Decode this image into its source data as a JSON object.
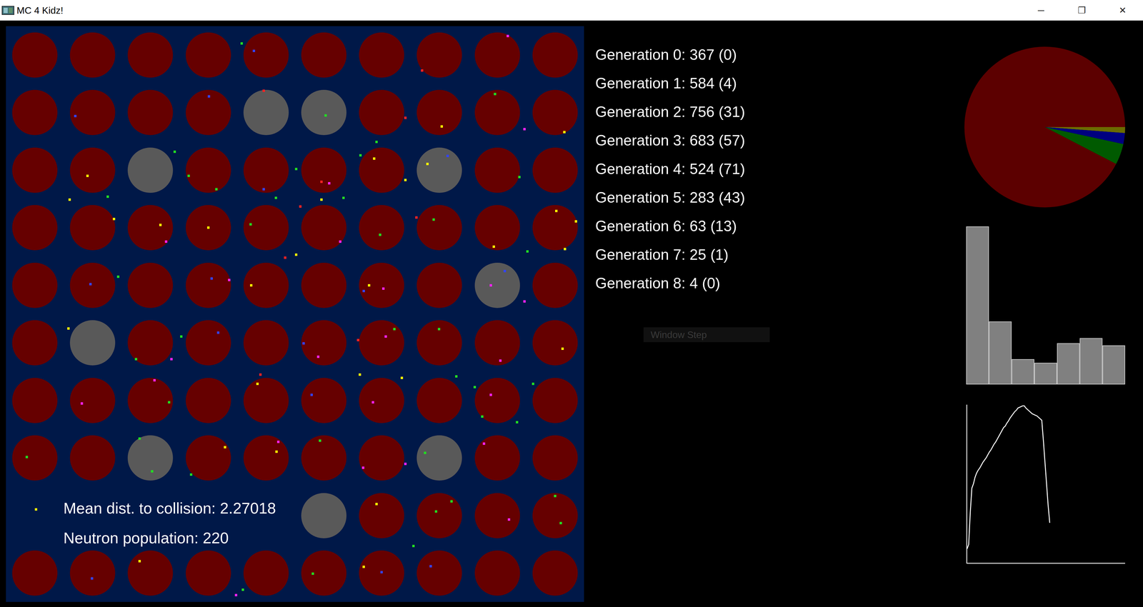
{
  "window": {
    "title": "MC 4 Kidz!",
    "controls": [
      "─",
      "❐",
      "✕"
    ]
  },
  "reactor": {
    "rows": [
      [
        "fuel",
        "fuel",
        "fuel",
        "fuel",
        "fuel",
        "fuel",
        "fuel",
        "fuel",
        "fuel",
        "fuel"
      ],
      [
        "fuel",
        "fuel",
        "fuel",
        "fuel",
        "spent",
        "spent",
        "fuel",
        "fuel",
        "fuel",
        "fuel"
      ],
      [
        "fuel",
        "fuel",
        "spent",
        "fuel",
        "fuel",
        "fuel",
        "fuel",
        "spent",
        "fuel",
        "fuel"
      ],
      [
        "fuel",
        "fuel",
        "fuel",
        "fuel",
        "fuel",
        "fuel",
        "fuel",
        "fuel",
        "fuel",
        "fuel"
      ],
      [
        "fuel",
        "fuel",
        "fuel",
        "fuel",
        "fuel",
        "fuel",
        "fuel",
        "fuel",
        "spent",
        "fuel"
      ],
      [
        "fuel",
        "spent",
        "fuel",
        "fuel",
        "fuel",
        "fuel",
        "fuel",
        "fuel",
        "fuel",
        "fuel"
      ],
      [
        "fuel",
        "fuel",
        "fuel",
        "fuel",
        "fuel",
        "fuel",
        "fuel",
        "fuel",
        "fuel",
        "fuel"
      ],
      [
        "fuel",
        "fuel",
        "spent",
        "fuel",
        "fuel",
        "fuel",
        "fuel",
        "spent",
        "fuel",
        "fuel"
      ],
      [
        "empty",
        "empty",
        "empty",
        "empty",
        "empty",
        "spent",
        "fuel",
        "fuel",
        "fuel",
        "fuel"
      ],
      [
        "fuel",
        "fuel",
        "fuel",
        "fuel",
        "fuel",
        "fuel",
        "fuel",
        "fuel",
        "fuel",
        "fuel"
      ]
    ],
    "neutrons": [
      {
        "x": 40.6,
        "y": 2.8,
        "color": "#22dd22"
      },
      {
        "x": 42.7,
        "y": 4.1,
        "color": "#3344ff"
      },
      {
        "x": 86.6,
        "y": 1.5,
        "color": "#ff22ff"
      },
      {
        "x": 71.8,
        "y": 7.5,
        "color": "#ff2222"
      },
      {
        "x": 34.9,
        "y": 12.0,
        "color": "#3344ff"
      },
      {
        "x": 11.8,
        "y": 15.4,
        "color": "#3344ff"
      },
      {
        "x": 44.4,
        "y": 11.0,
        "color": "#ff2222"
      },
      {
        "x": 55.1,
        "y": 15.3,
        "color": "#22dd22"
      },
      {
        "x": 84.4,
        "y": 11.6,
        "color": "#22dd22"
      },
      {
        "x": 75.2,
        "y": 17.2,
        "color": "#ffff00"
      },
      {
        "x": 68.9,
        "y": 15.7,
        "color": "#ff2222"
      },
      {
        "x": 89.5,
        "y": 17.7,
        "color": "#ff22ff"
      },
      {
        "x": 96.4,
        "y": 18.2,
        "color": "#ffff00"
      },
      {
        "x": 63.9,
        "y": 19.9,
        "color": "#22dd22"
      },
      {
        "x": 29.0,
        "y": 21.6,
        "color": "#22dd22"
      },
      {
        "x": 13.9,
        "y": 25.8,
        "color": "#ffff00"
      },
      {
        "x": 31.4,
        "y": 25.8,
        "color": "#22dd22"
      },
      {
        "x": 36.2,
        "y": 28.1,
        "color": "#22dd22"
      },
      {
        "x": 44.4,
        "y": 28.1,
        "color": "#3344ff"
      },
      {
        "x": 50.0,
        "y": 24.6,
        "color": "#22dd22"
      },
      {
        "x": 54.4,
        "y": 26.8,
        "color": "#ff2222"
      },
      {
        "x": 55.7,
        "y": 27.1,
        "color": "#ff22ff"
      },
      {
        "x": 61.1,
        "y": 22.2,
        "color": "#22dd22"
      },
      {
        "x": 63.5,
        "y": 22.8,
        "color": "#ffff00"
      },
      {
        "x": 72.7,
        "y": 23.7,
        "color": "#ffff00"
      },
      {
        "x": 76.2,
        "y": 22.3,
        "color": "#3344ff"
      },
      {
        "x": 68.9,
        "y": 26.5,
        "color": "#ffff00"
      },
      {
        "x": 88.6,
        "y": 26.0,
        "color": "#22dd22"
      },
      {
        "x": 17.4,
        "y": 29.4,
        "color": "#22dd22"
      },
      {
        "x": 10.8,
        "y": 29.9,
        "color": "#ffff00"
      },
      {
        "x": 46.5,
        "y": 29.6,
        "color": "#22dd22"
      },
      {
        "x": 50.7,
        "y": 31.1,
        "color": "#ff2222"
      },
      {
        "x": 54.4,
        "y": 29.9,
        "color": "#ffff00"
      },
      {
        "x": 58.2,
        "y": 29.6,
        "color": "#22dd22"
      },
      {
        "x": 18.5,
        "y": 33.3,
        "color": "#ffff00"
      },
      {
        "x": 26.5,
        "y": 34.3,
        "color": "#ffff00"
      },
      {
        "x": 27.5,
        "y": 37.2,
        "color": "#ff22ff"
      },
      {
        "x": 34.8,
        "y": 34.8,
        "color": "#ffff00"
      },
      {
        "x": 42.1,
        "y": 34.2,
        "color": "#22dd22"
      },
      {
        "x": 57.6,
        "y": 37.2,
        "color": "#ff22ff"
      },
      {
        "x": 64.5,
        "y": 36.0,
        "color": "#22dd22"
      },
      {
        "x": 70.8,
        "y": 33.0,
        "color": "#ff2222"
      },
      {
        "x": 73.8,
        "y": 33.4,
        "color": "#22dd22"
      },
      {
        "x": 84.2,
        "y": 38.1,
        "color": "#ffff00"
      },
      {
        "x": 95.0,
        "y": 31.9,
        "color": "#ffff00"
      },
      {
        "x": 98.4,
        "y": 33.7,
        "color": "#ffff00"
      },
      {
        "x": 90.0,
        "y": 38.9,
        "color": "#22dd22"
      },
      {
        "x": 96.5,
        "y": 38.5,
        "color": "#ffff00"
      },
      {
        "x": 14.4,
        "y": 44.6,
        "color": "#3344ff"
      },
      {
        "x": 19.2,
        "y": 43.3,
        "color": "#22dd22"
      },
      {
        "x": 35.4,
        "y": 43.6,
        "color": "#3344ff"
      },
      {
        "x": 38.4,
        "y": 43.9,
        "color": "#ff22ff"
      },
      {
        "x": 42.2,
        "y": 44.8,
        "color": "#ffff00"
      },
      {
        "x": 48.1,
        "y": 40.0,
        "color": "#ff2222"
      },
      {
        "x": 50.0,
        "y": 39.5,
        "color": "#ffff00"
      },
      {
        "x": 62.6,
        "y": 44.8,
        "color": "#ffff00"
      },
      {
        "x": 61.7,
        "y": 45.8,
        "color": "#3344ff"
      },
      {
        "x": 65.1,
        "y": 45.4,
        "color": "#ff22ff"
      },
      {
        "x": 83.7,
        "y": 44.8,
        "color": "#ff22ff"
      },
      {
        "x": 86.1,
        "y": 42.3,
        "color": "#3344ff"
      },
      {
        "x": 89.5,
        "y": 47.6,
        "color": "#ff22ff"
      },
      {
        "x": 10.6,
        "y": 52.3,
        "color": "#ffff00"
      },
      {
        "x": 30.1,
        "y": 53.7,
        "color": "#22dd22"
      },
      {
        "x": 36.5,
        "y": 53.0,
        "color": "#3344ff"
      },
      {
        "x": 51.3,
        "y": 54.9,
        "color": "#3344ff"
      },
      {
        "x": 53.8,
        "y": 57.2,
        "color": "#ff22ff"
      },
      {
        "x": 60.7,
        "y": 54.3,
        "color": "#ff2222"
      },
      {
        "x": 65.5,
        "y": 53.7,
        "color": "#ff22ff"
      },
      {
        "x": 67.0,
        "y": 52.4,
        "color": "#22dd22"
      },
      {
        "x": 74.7,
        "y": 52.4,
        "color": "#22dd22"
      },
      {
        "x": 85.3,
        "y": 57.9,
        "color": "#ff22ff"
      },
      {
        "x": 96.1,
        "y": 55.8,
        "color": "#ffff00"
      },
      {
        "x": 22.3,
        "y": 57.6,
        "color": "#22dd22"
      },
      {
        "x": 28.4,
        "y": 57.6,
        "color": "#ff22ff"
      },
      {
        "x": 12.9,
        "y": 65.3,
        "color": "#ff22ff"
      },
      {
        "x": 25.5,
        "y": 61.3,
        "color": "#ff22ff"
      },
      {
        "x": 28.0,
        "y": 65.1,
        "color": "#22dd22"
      },
      {
        "x": 43.3,
        "y": 61.9,
        "color": "#ffff00"
      },
      {
        "x": 43.8,
        "y": 60.3,
        "color": "#ff2222"
      },
      {
        "x": 52.7,
        "y": 63.8,
        "color": "#3344ff"
      },
      {
        "x": 61.0,
        "y": 60.3,
        "color": "#ffff00"
      },
      {
        "x": 63.3,
        "y": 65.1,
        "color": "#ff22ff"
      },
      {
        "x": 68.3,
        "y": 60.9,
        "color": "#ffff00"
      },
      {
        "x": 77.7,
        "y": 60.6,
        "color": "#22dd22"
      },
      {
        "x": 80.9,
        "y": 62.5,
        "color": "#22dd22"
      },
      {
        "x": 83.7,
        "y": 63.8,
        "color": "#ff22ff"
      },
      {
        "x": 82.2,
        "y": 67.6,
        "color": "#22dd22"
      },
      {
        "x": 88.2,
        "y": 68.6,
        "color": "#22dd22"
      },
      {
        "x": 91.0,
        "y": 61.9,
        "color": "#22dd22"
      },
      {
        "x": 46.9,
        "y": 72.0,
        "color": "#ff22ff"
      },
      {
        "x": 46.6,
        "y": 73.7,
        "color": "#ffff00"
      },
      {
        "x": 37.7,
        "y": 72.9,
        "color": "#ffff00"
      },
      {
        "x": 54.1,
        "y": 71.8,
        "color": "#22dd22"
      },
      {
        "x": 72.3,
        "y": 73.9,
        "color": "#22dd22"
      },
      {
        "x": 82.5,
        "y": 72.3,
        "color": "#ff22ff"
      },
      {
        "x": 3.4,
        "y": 74.6,
        "color": "#22dd22"
      },
      {
        "x": 22.9,
        "y": 71.4,
        "color": "#22dd22"
      },
      {
        "x": 25.1,
        "y": 77.1,
        "color": "#22dd22"
      },
      {
        "x": 31.8,
        "y": 77.7,
        "color": "#22dd22"
      },
      {
        "x": 68.9,
        "y": 75.8,
        "color": "#ff22ff"
      },
      {
        "x": 61.6,
        "y": 76.5,
        "color": "#ff22ff"
      },
      {
        "x": 5.0,
        "y": 83.7,
        "color": "#ffff00"
      },
      {
        "x": 63.9,
        "y": 82.8,
        "color": "#ffff00"
      },
      {
        "x": 74.2,
        "y": 84.1,
        "color": "#22dd22"
      },
      {
        "x": 76.9,
        "y": 82.3,
        "color": "#22dd22"
      },
      {
        "x": 86.8,
        "y": 85.5,
        "color": "#ff22ff"
      },
      {
        "x": 94.8,
        "y": 81.4,
        "color": "#22dd22"
      },
      {
        "x": 95.8,
        "y": 86.1,
        "color": "#22dd22"
      },
      {
        "x": 70.3,
        "y": 90.1,
        "color": "#22dd22"
      },
      {
        "x": 22.9,
        "y": 92.7,
        "color": "#ffff00"
      },
      {
        "x": 14.7,
        "y": 95.7,
        "color": "#3344ff"
      },
      {
        "x": 40.8,
        "y": 97.7,
        "color": "#22dd22"
      },
      {
        "x": 52.9,
        "y": 94.9,
        "color": "#22dd22"
      },
      {
        "x": 61.7,
        "y": 93.7,
        "color": "#ffff00"
      },
      {
        "x": 64.8,
        "y": 94.6,
        "color": "#3344ff"
      },
      {
        "x": 73.3,
        "y": 93.6,
        "color": "#3344ff"
      },
      {
        "x": 39.6,
        "y": 98.6,
        "color": "#ff22ff"
      }
    ],
    "stats": [
      "Mean dist. to collision: 2.27018",
      "Neutron population: 220"
    ]
  },
  "generations": [
    "Generation 0: 367 (0)",
    "Generation 1: 584 (4)",
    "Generation 2: 756 (31)",
    "Generation 3: 683 (57)",
    "Generation 4: 524 (71)",
    "Generation 5: 283 (43)",
    "Generation 6: 63 (13)",
    "Generation 7: 25 (1)",
    "Generation 8: 4 (0)"
  ],
  "window_step_button": {
    "label": "Window Step",
    "disabled": true
  },
  "pie_chart": {
    "slices": [
      {
        "value": 0.012,
        "color": "#6b6b00"
      },
      {
        "value": 0.022,
        "color": "#000080"
      },
      {
        "value": 0.042,
        "color": "#005a00"
      },
      {
        "value": 0.924,
        "color": "#5c0000"
      }
    ]
  },
  "histogram": {
    "y_max": 217,
    "values": [
      217,
      86,
      34,
      29,
      56,
      63,
      53
    ]
  },
  "line_chart": {
    "y_max": 218,
    "x_max": 100,
    "values": [
      20,
      26,
      70,
      104,
      110,
      119,
      125,
      129,
      132,
      136,
      140,
      143,
      146,
      150,
      154,
      157,
      161,
      165,
      168,
      172,
      176,
      180,
      184,
      188,
      190,
      194,
      197,
      201,
      204,
      207,
      210,
      212,
      215,
      216,
      217,
      218,
      218,
      215,
      213,
      211,
      209,
      207,
      206,
      205,
      204,
      202,
      200,
      198,
      170,
      140,
      110,
      80,
      56
    ]
  }
}
